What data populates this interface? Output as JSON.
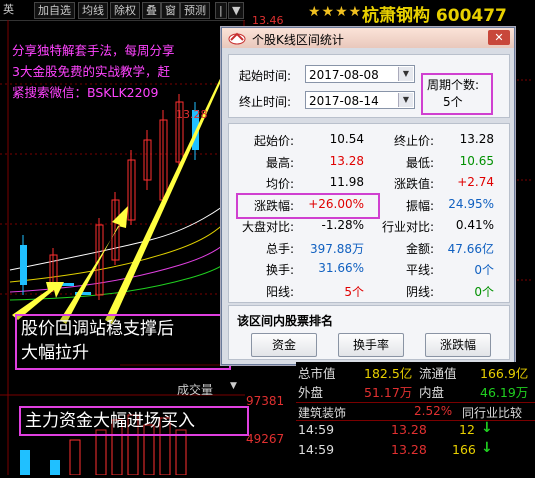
{
  "toolbar": {
    "items": [
      "英",
      "加自选",
      "均线",
      "除权",
      "叠",
      "窗",
      "预测"
    ],
    "more": "▼"
  },
  "header": {
    "stars": "★★★★",
    "stock_name": "杭萧钢构 600477",
    "price_label": "13.46"
  },
  "chart": {
    "high_label": "13.28",
    "volume_label": "成交量",
    "vol_values": [
      "97381",
      "49267"
    ]
  },
  "promo": {
    "line1": "分享独特解套手法，每周分享",
    "line2": "3大金股免费的实战教学，赶",
    "line3": "紧搜索微信：BSKLK2209"
  },
  "annotations": {
    "box1_line1": "股价回调站稳支撑后",
    "box1_line2": "大幅拉升",
    "box2": "主力资金大幅进场买入"
  },
  "dialog": {
    "title": "个股K线区间统计",
    "close": "✕",
    "start_label": "起始时间:",
    "start_value": "2017-08-08",
    "end_label": "终止时间:",
    "end_value": "2017-08-14",
    "period_label": "周期个数:",
    "period_value": "5个",
    "stats": [
      {
        "l": "起始价:",
        "v": "10.54",
        "c": "#000000",
        "l2": "终止价:",
        "v2": "13.28",
        "c2": "#000000"
      },
      {
        "l": "最高:",
        "v": "13.28",
        "c": "#e00000",
        "l2": "最低:",
        "v2": "10.65",
        "c2": "#009000"
      },
      {
        "l": "均价:",
        "v": "11.98",
        "c": "#000000",
        "l2": "涨跌值:",
        "v2": "+2.74",
        "c2": "#e00000"
      },
      {
        "l": "涨跌幅:",
        "v": "+26.00%",
        "c": "#e00000",
        "l2": "振幅:",
        "v2": "24.95%",
        "c2": "#1060c0"
      },
      {
        "l": "大盘对比:",
        "v": "-1.28%",
        "c": "#000000",
        "l2": "行业对比:",
        "v2": "0.41%",
        "c2": "#000000"
      },
      {
        "l": "总手:",
        "v": "397.88万",
        "c": "#1060c0",
        "l2": "金额:",
        "v2": "47.66亿",
        "c2": "#1060c0"
      },
      {
        "l": "换手:",
        "v": "31.66%",
        "c": "#1060c0",
        "l2": "平线:",
        "v2": "0个",
        "c2": "#1060c0"
      },
      {
        "l": "阳线:",
        "v": "5个",
        "c": "#e00000",
        "l2": "阴线:",
        "v2": "0个",
        "c2": "#009000"
      }
    ],
    "rank_title": "该区间内股票排名",
    "buttons": [
      "资金",
      "换手率",
      "涨跌幅"
    ]
  },
  "rpanel": {
    "row1": {
      "a": "总市值",
      "b": "182.5亿",
      "c": "流通值",
      "d": "166.9亿"
    },
    "row2": {
      "a": "外盘",
      "b": "51.17万",
      "c": "内盘",
      "d": "46.19万"
    },
    "row3": {
      "a": "建筑装饰",
      "b": "2.52%",
      "c": "同行业比较"
    },
    "trades": [
      {
        "t": "14:59",
        "p": "13.28",
        "n": "12",
        "arrow": "↓"
      },
      {
        "t": "14:59",
        "p": "13.28",
        "n": "166",
        "arrow": "↓"
      }
    ]
  },
  "colors": {
    "accent": "#e040e0",
    "up": "#e03030",
    "down": "#20c020",
    "name": "#e8d000"
  }
}
